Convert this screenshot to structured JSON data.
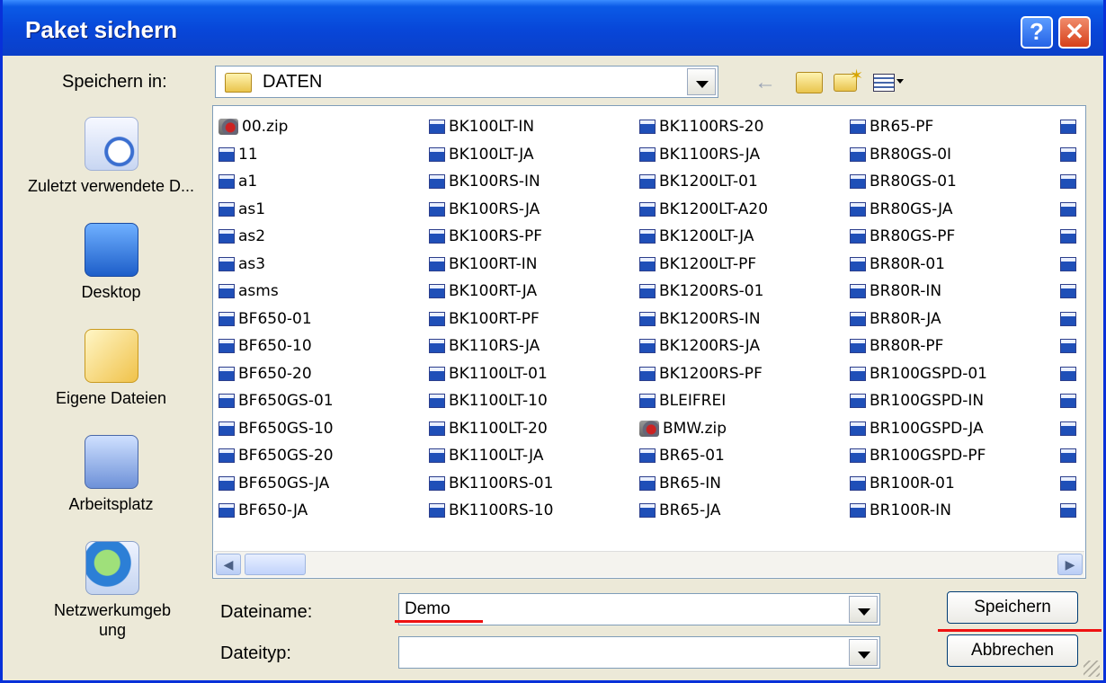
{
  "window": {
    "title": "Paket sichern",
    "help_label": "?",
    "close_label": "✕"
  },
  "location": {
    "label": "Speichern in:",
    "value": "DATEN"
  },
  "places": [
    {
      "label": "Zuletzt verwendete D...",
      "icon": "recent-documents-icon"
    },
    {
      "label": "Desktop",
      "icon": "desktop-icon"
    },
    {
      "label": "Eigene Dateien",
      "icon": "my-documents-icon"
    },
    {
      "label": "Arbeitsplatz",
      "icon": "my-computer-icon"
    },
    {
      "label": "Netzwerkumgebung",
      "icon": "network-places-icon"
    }
  ],
  "files": {
    "col1": [
      "00.zip",
      "11",
      "a1",
      "as1",
      "as2",
      "as3",
      "asms",
      "BF650-01",
      "BF650-10",
      "BF650-20",
      "BF650GS-01",
      "BF650GS-10",
      "BF650GS-20",
      "BF650GS-JA",
      "BF650-JA"
    ],
    "col2": [
      "BK100LT-IN",
      "BK100LT-JA",
      "BK100RS-IN",
      "BK100RS-JA",
      "BK100RS-PF",
      "BK100RT-IN",
      "BK100RT-JA",
      "BK100RT-PF",
      "BK110RS-JA",
      "BK1100LT-01",
      "BK1100LT-10",
      "BK1100LT-20",
      "BK1100LT-JA",
      "BK1100RS-01",
      "BK1100RS-10"
    ],
    "col3": [
      "BK1100RS-20",
      "BK1100RS-JA",
      "BK1200LT-01",
      "BK1200LT-A20",
      "BK1200LT-JA",
      "BK1200LT-PF",
      "BK1200RS-01",
      "BK1200RS-IN",
      "BK1200RS-JA",
      "BK1200RS-PF",
      "BLEIFREI",
      "BMW.zip",
      "BR65-01",
      "BR65-IN",
      "BR65-JA"
    ],
    "col4": [
      "BR65-PF",
      "BR80GS-0I",
      "BR80GS-01",
      "BR80GS-JA",
      "BR80GS-PF",
      "BR80R-01",
      "BR80R-IN",
      "BR80R-JA",
      "BR80R-PF",
      "BR100GSPD-01",
      "BR100GSPD-IN",
      "BR100GSPD-JA",
      "BR100GSPD-PF",
      "BR100R-01",
      "BR100R-IN"
    ]
  },
  "filename": {
    "label": "Dateiname:",
    "value": "Demo"
  },
  "filetype": {
    "label": "Dateityp:",
    "value": ""
  },
  "buttons": {
    "save": "Speichern",
    "cancel": "Abbrechen"
  },
  "colors": {
    "titlebar": "#0a52e0",
    "annotation": "#e11111"
  }
}
